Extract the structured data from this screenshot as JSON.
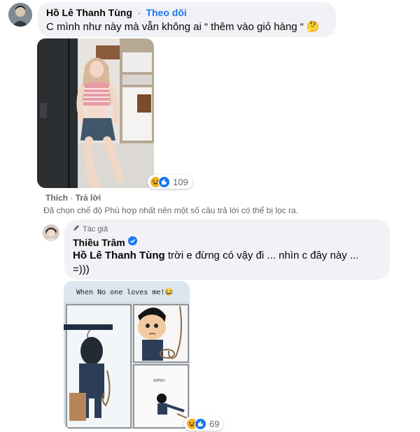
{
  "comment1": {
    "author": "Hồ Lê Thanh Tùng",
    "separator": "·",
    "follow_label": "Theo dõi",
    "text": "C mình như này mà vẫn không ai “ thêm vào giỏ hàng “ 🤔",
    "reaction_count": "109",
    "actions": {
      "like": "Thích",
      "dot": "·",
      "reply": "Trả lời"
    }
  },
  "filter_notice": "Đã chọn chế độ Phù hợp nhất nên một số câu trả lời có thể bị lọc ra.",
  "reply1": {
    "badge": "Tác giả",
    "author": "Thiều Trâm",
    "mention": "Hồ Lê Thanh Tùng",
    "text": " trời e đừng có vậy đi ... nhìn c đây này ...",
    "text_line2": "=)))",
    "meme_caption": "When No one loves me!😂",
    "meme_small_text": "GGFOO!",
    "reaction_count": "69"
  },
  "colors": {
    "bubble": "#f0f2f5",
    "link_blue": "#1877f2",
    "meta_gray": "#65676b",
    "haha_yellow": "#f7b125",
    "like_blue": "#1877f2"
  },
  "icons": [
    "haha-reaction-icon",
    "like-reaction-icon",
    "pencil-icon",
    "verified-badge-icon"
  ]
}
